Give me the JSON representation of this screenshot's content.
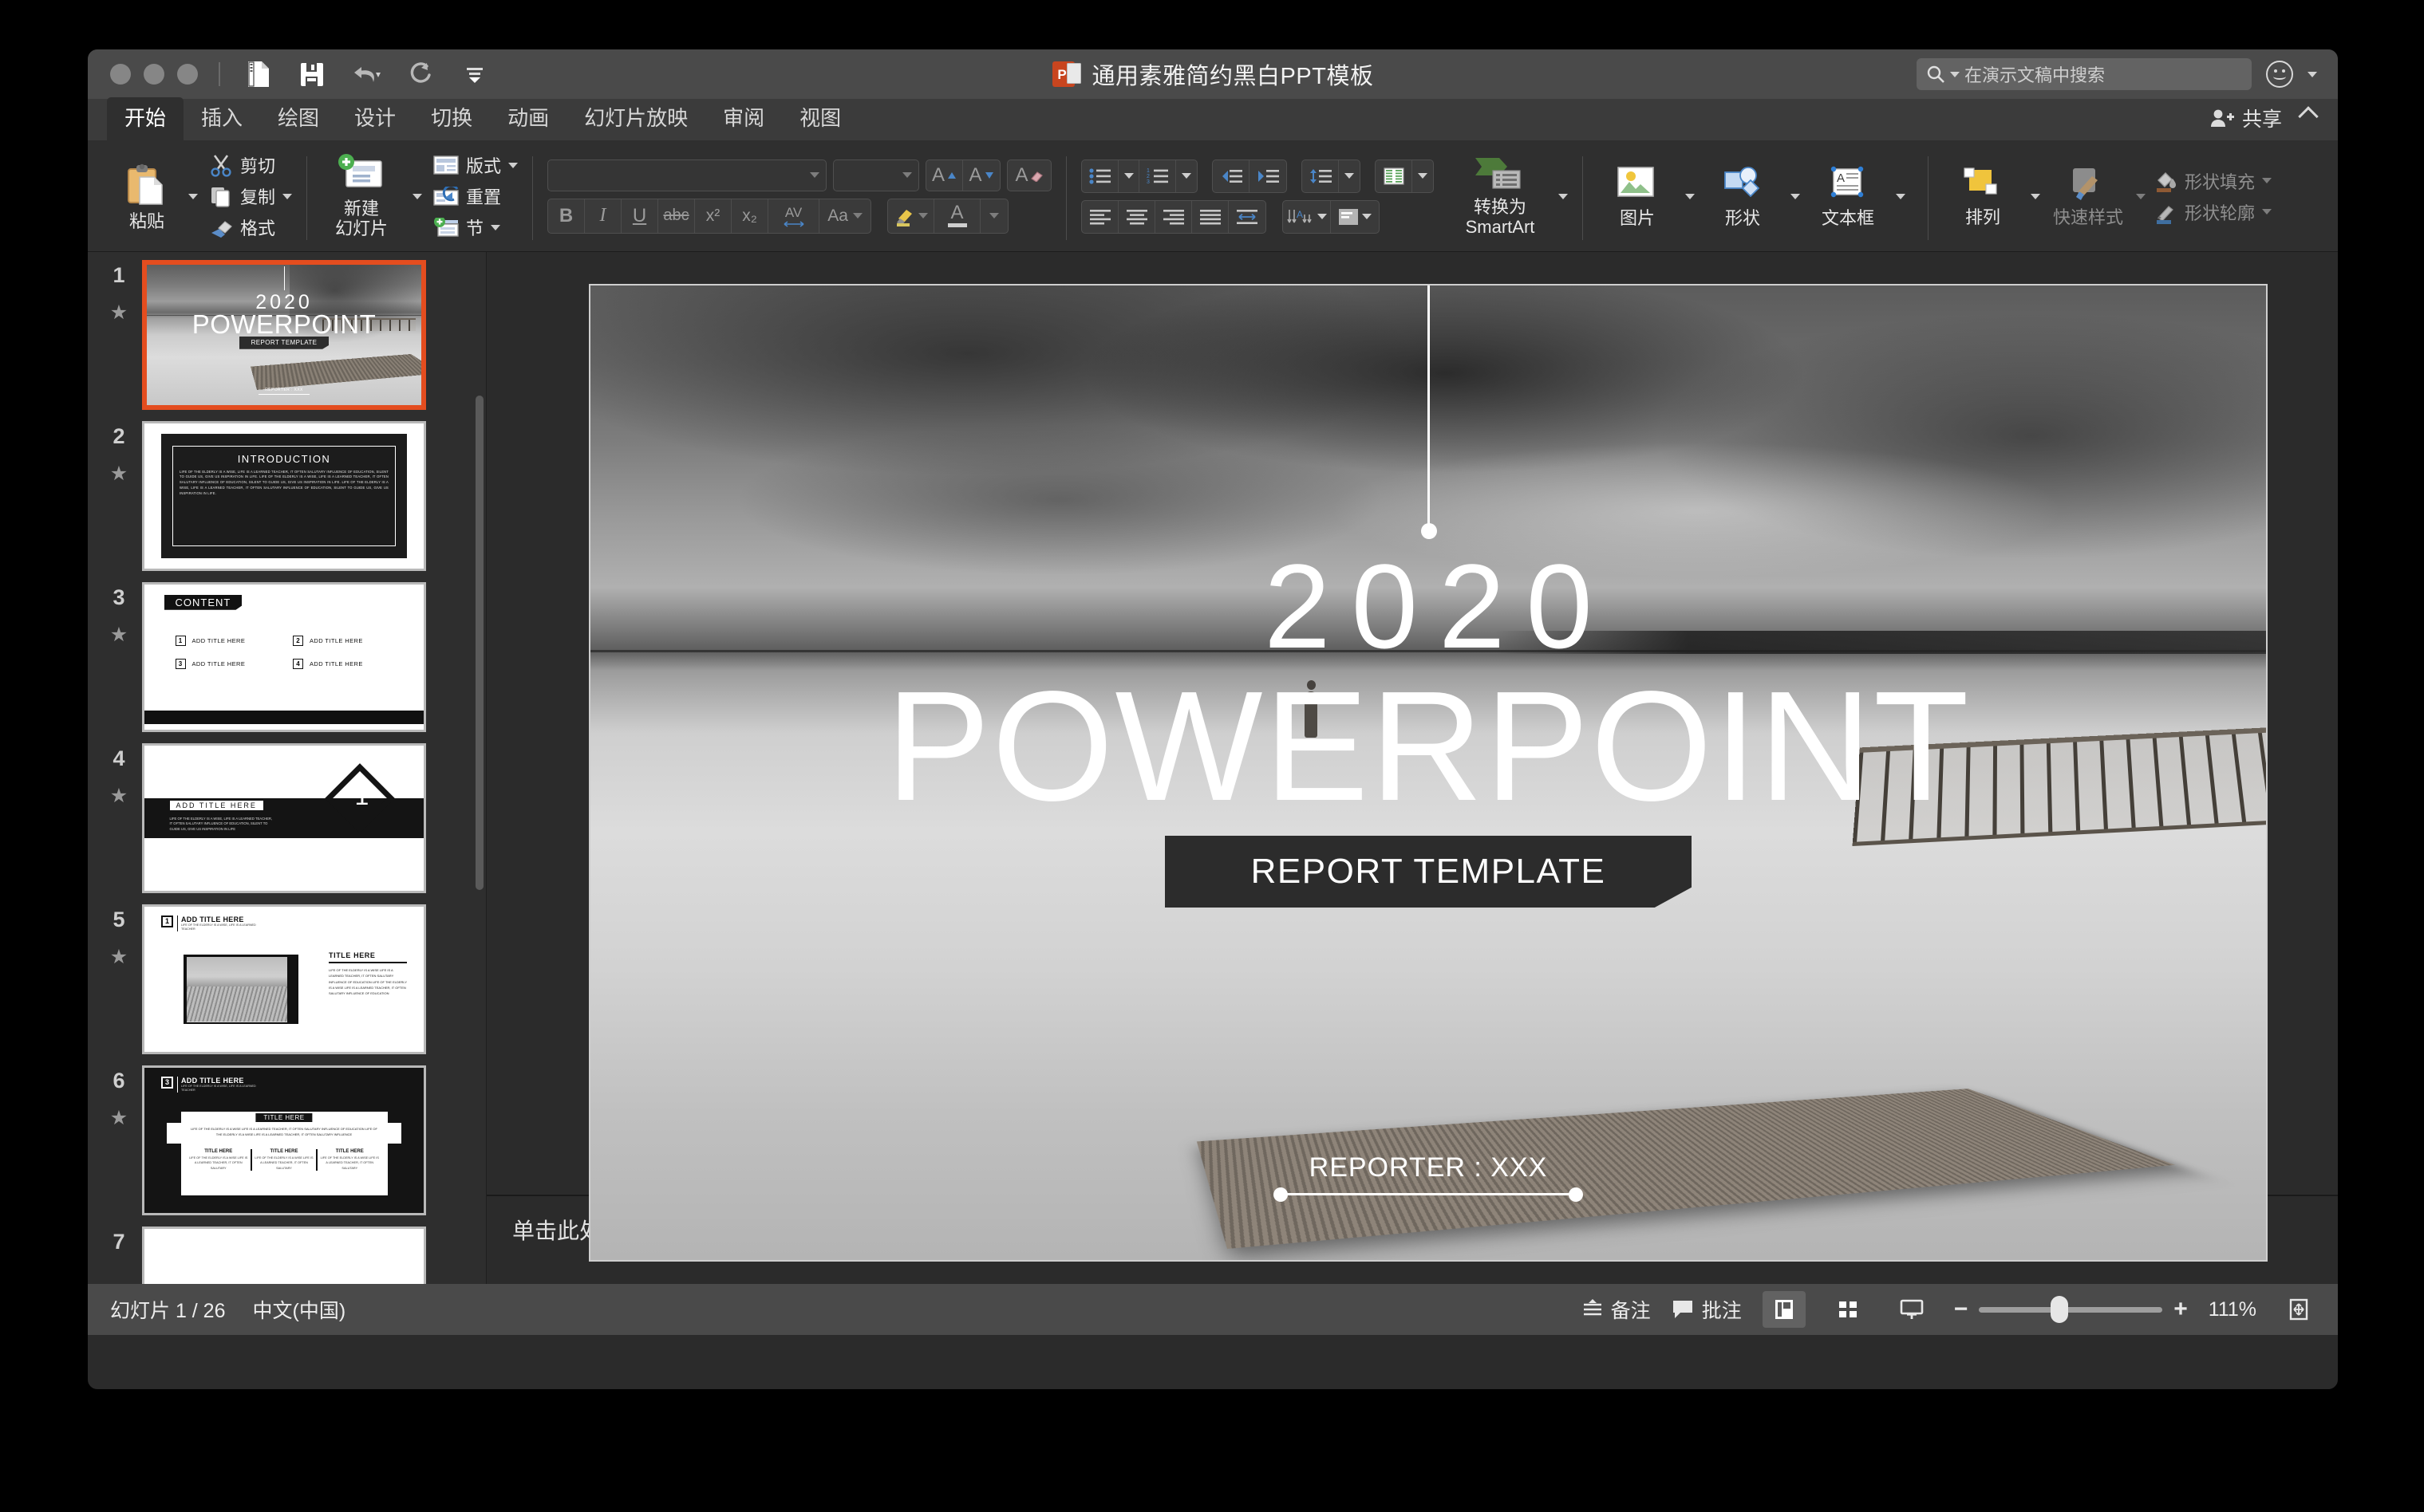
{
  "window": {
    "title": "通用素雅简约黑白PPT模板",
    "app_icon": "powerpoint-icon",
    "traffic_lights": [
      "close",
      "minimize",
      "zoom"
    ]
  },
  "quick_access": {
    "items": [
      {
        "name": "new-presentation-icon",
        "label": "新建"
      },
      {
        "name": "save-icon",
        "label": "保存"
      },
      {
        "name": "undo-icon",
        "label": "撤消"
      },
      {
        "name": "redo-icon",
        "label": "恢复"
      },
      {
        "name": "customize-toolbar-icon",
        "label": "自定义快速访问工具栏"
      }
    ]
  },
  "search": {
    "placeholder": "在演示文稿中搜索",
    "icon": "search-icon"
  },
  "account": {
    "icon": "smiley-face-icon"
  },
  "ribbon": {
    "tabs": [
      {
        "label": "开始",
        "active": true
      },
      {
        "label": "插入",
        "active": false
      },
      {
        "label": "绘图",
        "active": false
      },
      {
        "label": "设计",
        "active": false
      },
      {
        "label": "切换",
        "active": false
      },
      {
        "label": "动画",
        "active": false
      },
      {
        "label": "幻灯片放映",
        "active": false
      },
      {
        "label": "审阅",
        "active": false
      },
      {
        "label": "视图",
        "active": false
      }
    ],
    "share_label": "共享",
    "clipboard": {
      "paste": "粘贴",
      "cut": "剪切",
      "copy": "复制",
      "format_painter": "格式"
    },
    "slides": {
      "new_slide": "新建\n幻灯片",
      "new_slide_line1": "新建",
      "new_slide_line2": "幻灯片",
      "layout": "版式",
      "reset": "重置",
      "section": "节"
    },
    "font": {
      "font_name_value": "",
      "font_size_value": "",
      "grow_font": "A",
      "shrink_font": "A",
      "clear_format": "A",
      "bold": "B",
      "italic": "I",
      "underline": "U",
      "strikethrough": "abc",
      "superscript": "x²",
      "subscript": "x₂",
      "spacing": "AV",
      "change_case": "Aa",
      "highlight": "highlight-icon",
      "font_color": "A"
    },
    "paragraph": {
      "bullets": "bullet-list-icon",
      "numbering": "numbered-list-icon",
      "decrease_indent": "decrease-indent-icon",
      "increase_indent": "increase-indent-icon",
      "line_spacing": "line-spacing-icon",
      "columns": "columns-icon",
      "smartart_line1": "转换为",
      "smartart_line2": "SmartArt",
      "align_left": "align-left-icon",
      "align_center": "align-center-icon",
      "align_right": "align-right-icon",
      "justify": "justify-icon",
      "distribute": "distribute-icon",
      "text_direction": "text-direction-icon",
      "align_text": "align-text-icon"
    },
    "insert": {
      "picture": "图片",
      "shapes": "形状",
      "textbox": "文本框"
    },
    "drawing": {
      "arrange": "排列",
      "quick_styles": "快速样式",
      "shape_fill": "形状填充",
      "shape_outline": "形状轮廓"
    }
  },
  "thumbnails": [
    {
      "num": "1",
      "selected": true,
      "kind": "title",
      "star": true
    },
    {
      "num": "2",
      "selected": false,
      "kind": "introduction",
      "star": true
    },
    {
      "num": "3",
      "selected": false,
      "kind": "content",
      "star": true
    },
    {
      "num": "4",
      "selected": false,
      "kind": "section1",
      "star": true
    },
    {
      "num": "5",
      "selected": false,
      "kind": "image-text",
      "star": true
    },
    {
      "num": "6",
      "selected": false,
      "kind": "three-col",
      "star": true
    },
    {
      "num": "7",
      "selected": false,
      "kind": "partial",
      "star": false
    }
  ],
  "thumb_text": {
    "introduction_title": "INTRODUCTION",
    "introduction_body": "LIFE OF THE ELDERLY IS A WISE, LIFE IS A LEARNED TEACHER, IT OFTEN SALUTARY INFLUENCE OF EDUCATION, SILENT TO GUIDE US, GIVE US INSPIRATION IN LIFE. LIFE OF THE ELDERLY IS A WISE, LIFE IS A LEARNED TEACHER, IT OFTEN SALUTARY INFLUENCE OF EDUCATION, SILENT TO GUIDE US, GIVE US INSPIRATION IN LIFE. LIFE OF THE ELDERLY IS A WISE, LIFE IS A LEARNED TEACHER, IT OFTEN SALUTARY INFLUENCE OF EDUCATION, SILENT TO GUIDE US, GIVE US INSPIRATION IN LIFE.",
    "content_title": "CONTENT",
    "content_items": [
      {
        "num": "1",
        "label": "ADD TITLE HERE"
      },
      {
        "num": "2",
        "label": "ADD TITLE HERE"
      },
      {
        "num": "3",
        "label": "ADD TITLE HERE"
      },
      {
        "num": "4",
        "label": "ADD TITLE HERE"
      }
    ],
    "section_number": "1",
    "section_title": "ADD TITLE HERE",
    "section_body": "LIFE OF THE ELDERLY IS A WISE, LIFE IS A LEARNED TEACHER, IT OFTEN SALUTARY INFLUENCE OF EDUCATION, SILENT TO GUIDE US, GIVE US INSPIRATION IN LIFE",
    "slide5_badge": "1",
    "slide5_header": "ADD TITLE HERE",
    "slide5_subheader": "LIFE OF THE ELDERLY IS A WISE, LIFE IS A LEARNED TEACHER",
    "slide5_title": "TITLE HERE",
    "slide5_body": "LIFE OF THE ELDERLY IS A WISE LIFE IS A LEARNED TEACHER, IT OFTEN SALUTARY INFLUENCE OF EDUCATION LIFE OF THE ELDERLY IS A WISE LIFE IS A LEARNED TEACHER, IT OFTEN SALUTARY INFLUENCE OF EDUCATION",
    "slide6_badge": "3",
    "slide6_header": "ADD TITLE HERE",
    "slide6_subheader": "LIFE OF THE ELDERLY IS A WISE, LIFE IS A LEARNED TEACHER",
    "slide6_title": "TITLE HERE",
    "slide6_body": "LIFE OF THE ELDERLY IS A WISE LIFE IS A LEARNED TEACHER, IT OFTEN SALUTARY INFLUENCE OF EDUCATION LIFE OF THE ELDERLY IS A WISE LIFE IS A LEARNED TEACHER, IT OFTEN SALUTARY INFLUENCE",
    "slide6_cols": [
      {
        "title": "TITLE HERE",
        "body": "LIFE OF THE ELDERLY IS A WISE LIFE IS A LEARNED TEACHER, IT OFTEN SALUTARY"
      },
      {
        "title": "TITLE HERE",
        "body": "LIFE OF THE ELDERLY IS A WISE LIFE IS A LEARNED TEACHER, IT OFTEN SALUTARY"
      },
      {
        "title": "TITLE HERE",
        "body": "LIFE OF THE ELDERLY IS A WISE LIFE IS A LEARNED TEACHER, IT OFTEN SALUTARY"
      }
    ]
  },
  "slide": {
    "year": "2020",
    "title": "POWERPOINT",
    "banner": "REPORT TEMPLATE",
    "reporter": "REPORTER : XXX"
  },
  "notes": {
    "placeholder": "单击此处添加备注"
  },
  "status": {
    "slide_counter": "幻灯片 1 / 26",
    "language": "中文(中国)",
    "notes_label": "备注",
    "comments_label": "批注",
    "zoom_level": "111%",
    "zoom_out": "−",
    "zoom_in": "+",
    "views": [
      {
        "name": "normal-view",
        "active": true
      },
      {
        "name": "slide-sorter-view",
        "active": false
      },
      {
        "name": "slideshow-view",
        "active": false
      }
    ],
    "fit_window": "fit-slide-to-window-icon"
  },
  "colors": {
    "accent_selection": "#e44d1f",
    "titlebar": "#4a4a4a",
    "ribbon": "#2f2f2f",
    "panel": "#2e2e2e",
    "canvas": "#2b2b2b"
  }
}
